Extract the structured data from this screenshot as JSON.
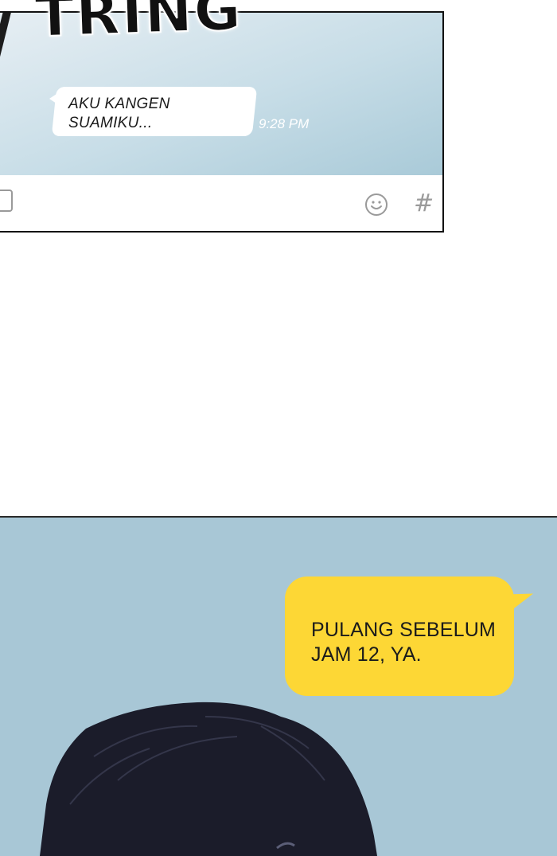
{
  "sound_effect": {
    "text": "TRING"
  },
  "phone_chat": {
    "incoming_message": {
      "text": "AKU KANGEN\nSUAMIKU...",
      "time": "9:28 PM"
    },
    "input_bar": {
      "icons": [
        "attachment-icon",
        "emoji-icon",
        "hashtag-icon"
      ],
      "hashtag_glyph": "#"
    }
  },
  "scene": {
    "outgoing_message": {
      "text": "PULANG SEBELUM\nJAM 12, YA."
    }
  },
  "colors": {
    "chat_background": "#c7dde7",
    "incoming_bubble": "#ffffff",
    "outgoing_bubble": "#fdd735",
    "scene_background": "#a8c7d6",
    "hair": "#1b1c2a"
  }
}
